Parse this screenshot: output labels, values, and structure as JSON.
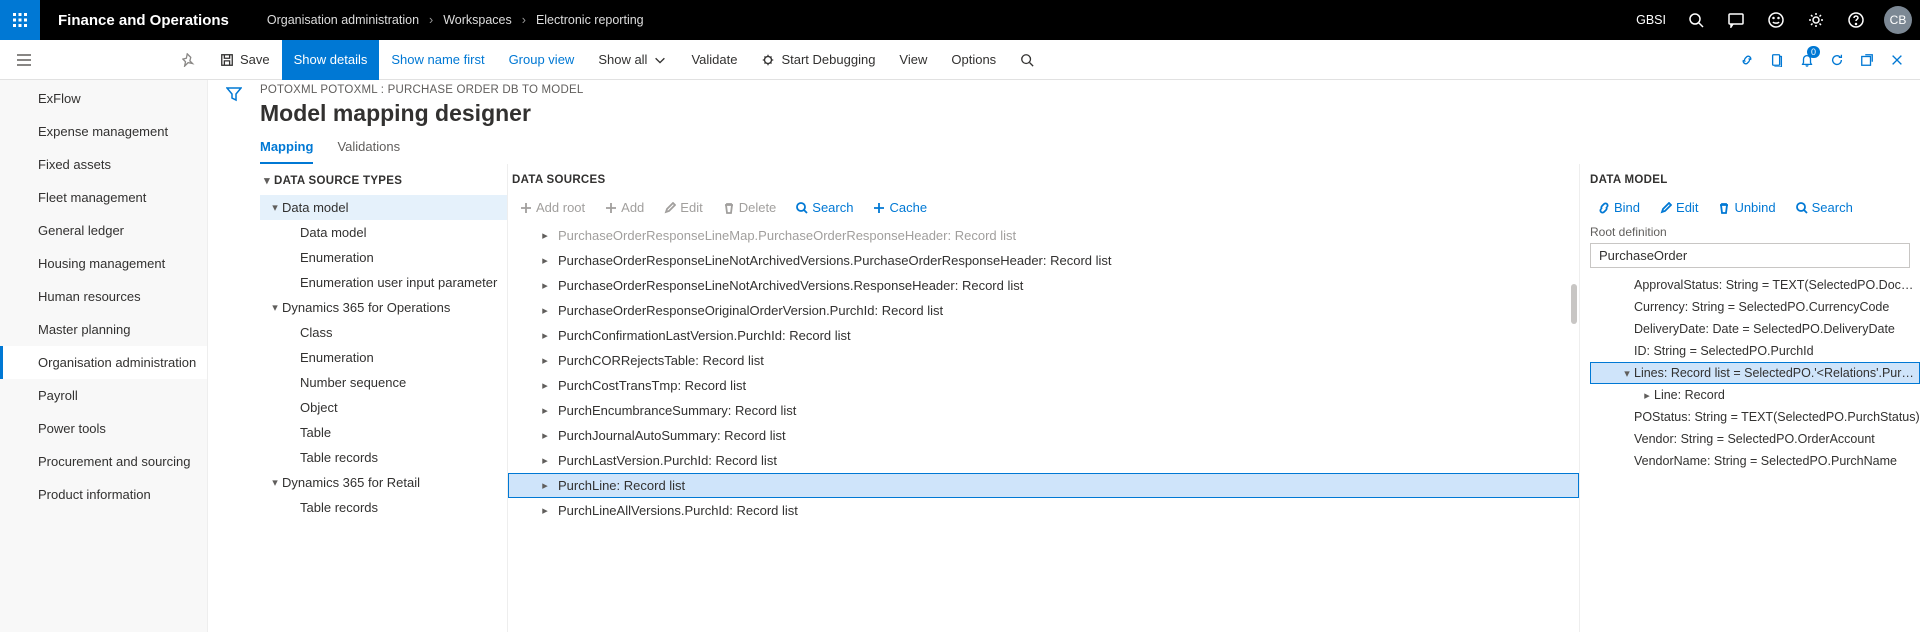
{
  "top": {
    "brand": "Finance and Operations",
    "crumbs": [
      "Organisation administration",
      "Workspaces",
      "Electronic reporting"
    ],
    "company": "GBSI",
    "avatar": "CB"
  },
  "cmd": {
    "save": "Save",
    "showDetails": "Show details",
    "showNameFirst": "Show name first",
    "groupView": "Group view",
    "showAll": "Show all",
    "validate": "Validate",
    "startDebugging": "Start Debugging",
    "view": "View",
    "options": "Options",
    "notifCount": "0"
  },
  "nav": {
    "items": [
      "ExFlow",
      "Expense management",
      "Fixed assets",
      "Fleet management",
      "General ledger",
      "Housing management",
      "Human resources",
      "Master planning",
      "Organisation administration",
      "Payroll",
      "Power tools",
      "Procurement and sourcing",
      "Product information"
    ],
    "selected": "Organisation administration"
  },
  "head": {
    "breadcrumb": "POTOXML POTOXML : PURCHASE ORDER DB TO MODEL",
    "title": "Model mapping designer",
    "tabs": [
      "Mapping",
      "Validations"
    ],
    "tabSel": "Mapping"
  },
  "typesPanel": {
    "title": "DATA SOURCE TYPES",
    "tree": [
      {
        "lv": 0,
        "exp": "▾",
        "t": "Data model",
        "hl": true
      },
      {
        "lv": 1,
        "exp": "",
        "t": "Data model"
      },
      {
        "lv": 1,
        "exp": "",
        "t": "Enumeration"
      },
      {
        "lv": 1,
        "exp": "",
        "t": "Enumeration user input parameter"
      },
      {
        "lv": 0,
        "exp": "▾",
        "t": "Dynamics 365 for Operations"
      },
      {
        "lv": 1,
        "exp": "",
        "t": "Class"
      },
      {
        "lv": 1,
        "exp": "",
        "t": "Enumeration"
      },
      {
        "lv": 1,
        "exp": "",
        "t": "Number sequence"
      },
      {
        "lv": 1,
        "exp": "",
        "t": "Object"
      },
      {
        "lv": 1,
        "exp": "",
        "t": "Table"
      },
      {
        "lv": 1,
        "exp": "",
        "t": "Table records"
      },
      {
        "lv": 0,
        "exp": "▾",
        "t": "Dynamics 365 for Retail"
      },
      {
        "lv": 1,
        "exp": "",
        "t": "Table records"
      }
    ]
  },
  "dsPanel": {
    "title": "DATA SOURCES",
    "toolbar": {
      "addRoot": "Add root",
      "add": "Add",
      "edit": "Edit",
      "delete": "Delete",
      "search": "Search",
      "cache": "Cache"
    },
    "rows": [
      {
        "exp": "▸",
        "t": "PurchaseOrderResponseLineMap.PurchaseOrderResponseHeader: Record list",
        "cut": true
      },
      {
        "exp": "▸",
        "t": "PurchaseOrderResponseLineNotArchivedVersions.PurchaseOrderResponseHeader: Record list"
      },
      {
        "exp": "▸",
        "t": "PurchaseOrderResponseLineNotArchivedVersions.ResponseHeader: Record list"
      },
      {
        "exp": "▸",
        "t": "PurchaseOrderResponseOriginalOrderVersion.PurchId: Record list"
      },
      {
        "exp": "▸",
        "t": "PurchConfirmationLastVersion.PurchId: Record list"
      },
      {
        "exp": "▸",
        "t": "PurchCORRejectsTable: Record list"
      },
      {
        "exp": "▸",
        "t": "PurchCostTransTmp: Record list"
      },
      {
        "exp": "▸",
        "t": "PurchEncumbranceSummary: Record list"
      },
      {
        "exp": "▸",
        "t": "PurchJournalAutoSummary: Record list"
      },
      {
        "exp": "▸",
        "t": "PurchLastVersion.PurchId: Record list"
      },
      {
        "exp": "▸",
        "t": "PurchLine: Record list",
        "sel": true
      },
      {
        "exp": "▸",
        "t": "PurchLineAllVersions.PurchId: Record list"
      }
    ]
  },
  "dmPanel": {
    "title": "DATA MODEL",
    "toolbar": {
      "bind": "Bind",
      "edit": "Edit",
      "unbind": "Unbind",
      "search": "Search"
    },
    "rootLabel": "Root definition",
    "rootValue": "PurchaseOrder",
    "rows": [
      {
        "lv": 1,
        "exp": "",
        "t": "ApprovalStatus: String = TEXT(SelectedPO.DocumentState"
      },
      {
        "lv": 1,
        "exp": "",
        "t": "Currency: String = SelectedPO.CurrencyCode"
      },
      {
        "lv": 1,
        "exp": "",
        "t": "DeliveryDate: Date = SelectedPO.DeliveryDate"
      },
      {
        "lv": 1,
        "exp": "",
        "t": "ID: String = SelectedPO.PurchId"
      },
      {
        "lv": 1,
        "exp": "▾",
        "t": "Lines: Record list = SelectedPO.'<Relations'.PurchLine",
        "sel": true
      },
      {
        "lv": 2,
        "exp": "▸",
        "t": "Line: Record"
      },
      {
        "lv": 1,
        "exp": "",
        "t": "POStatus: String = TEXT(SelectedPO.PurchStatus)"
      },
      {
        "lv": 1,
        "exp": "",
        "t": "Vendor: String = SelectedPO.OrderAccount"
      },
      {
        "lv": 1,
        "exp": "",
        "t": "VendorName: String = SelectedPO.PurchName"
      }
    ]
  }
}
